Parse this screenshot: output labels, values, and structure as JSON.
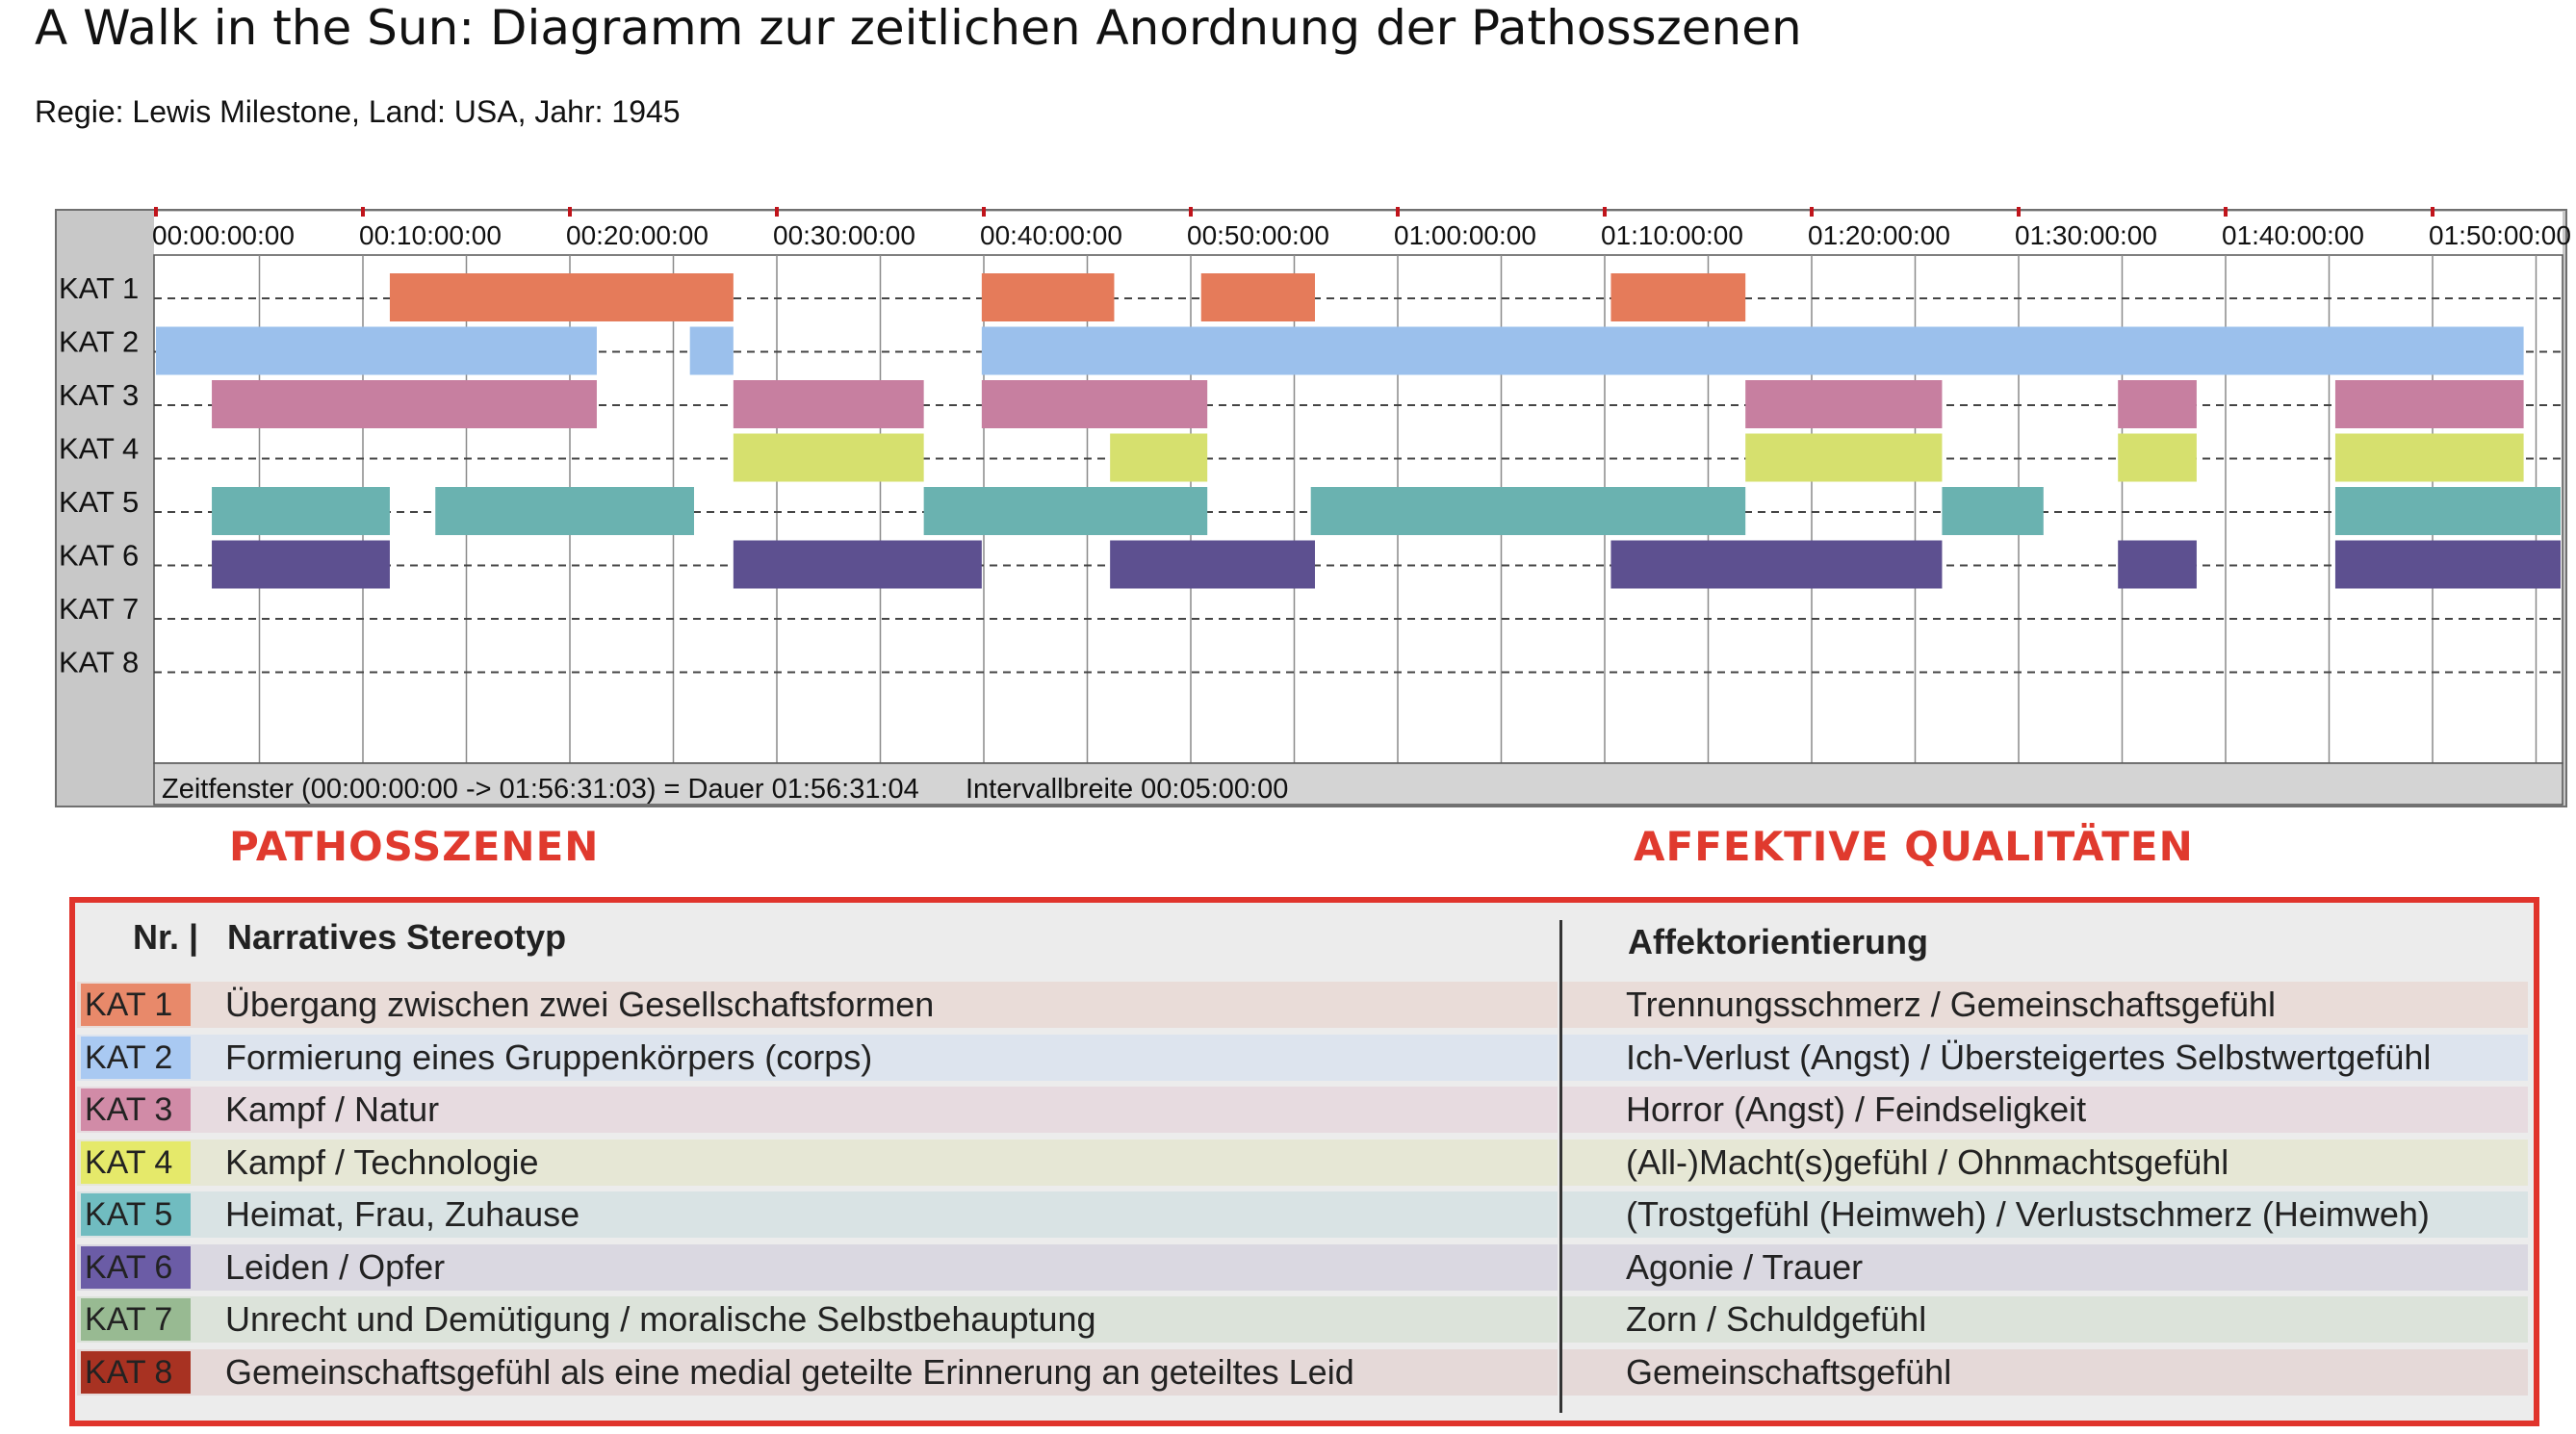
{
  "page": {
    "title": "A Walk in the Sun: Diagramm zur zeitlichen Anordnung der Pathosszenen",
    "subtitle": "Regie: Lewis Milestone, Land: USA, Jahr: 1945"
  },
  "chart_data": {
    "type": "timeline",
    "x_unit": "minutes",
    "xlim": [
      0,
      116.5
    ],
    "x_ticks": [
      {
        "value": 0,
        "label": "00:00:00:00"
      },
      {
        "value": 10,
        "label": "00:10:00:00"
      },
      {
        "value": 20,
        "label": "00:20:00:00"
      },
      {
        "value": 30,
        "label": "00:30:00:00"
      },
      {
        "value": 40,
        "label": "00:40:00:00"
      },
      {
        "value": 50,
        "label": "00:50:00:00"
      },
      {
        "value": 60,
        "label": "01:00:00:00"
      },
      {
        "value": 70,
        "label": "01:10:00:00"
      },
      {
        "value": 80,
        "label": "01:20:00:00"
      },
      {
        "value": 90,
        "label": "01:30:00:00"
      },
      {
        "value": 100,
        "label": "01:40:00:00"
      },
      {
        "value": 110,
        "label": "01:50:00:00"
      }
    ],
    "minor_grid_offset": 5,
    "categories": [
      "KAT 1",
      "KAT 2",
      "KAT 3",
      "KAT 4",
      "KAT 5",
      "KAT 6",
      "KAT 7",
      "KAT 8"
    ],
    "colors": [
      "#e57b5a",
      "#9bc0ec",
      "#c77fa0",
      "#d6e06e",
      "#6ab2b0",
      "#5d5090",
      "#8aaf84",
      "#9a2a1c"
    ],
    "segments": [
      [
        [
          11.3,
          27.9
        ],
        [
          39.9,
          46.3
        ],
        [
          50.5,
          56.0
        ],
        [
          70.3,
          76.8
        ]
      ],
      [
        [
          0,
          21.3
        ],
        [
          25.8,
          27.9
        ],
        [
          39.9,
          114.4
        ]
      ],
      [
        [
          2.7,
          21.3
        ],
        [
          27.9,
          37.1
        ],
        [
          39.9,
          50.8
        ],
        [
          76.8,
          86.3
        ],
        [
          94.8,
          98.6
        ],
        [
          105.3,
          114.4
        ]
      ],
      [
        [
          27.9,
          37.1
        ],
        [
          46.1,
          50.8
        ],
        [
          76.8,
          86.3
        ],
        [
          94.8,
          98.6
        ],
        [
          105.3,
          114.4
        ]
      ],
      [
        [
          2.7,
          11.3
        ],
        [
          13.5,
          26.0
        ],
        [
          37.1,
          50.8
        ],
        [
          55.8,
          76.8
        ],
        [
          86.3,
          91.2
        ],
        [
          105.3,
          116.5
        ]
      ],
      [
        [
          2.7,
          11.3
        ],
        [
          27.9,
          39.9
        ],
        [
          46.1,
          56.0
        ],
        [
          70.3,
          86.3
        ],
        [
          94.8,
          98.6
        ],
        [
          105.3,
          116.5
        ]
      ],
      [],
      []
    ],
    "footer": "Zeitfenster (00:00:00:00 -> 01:56:31:03) = Dauer 01:56:31:04",
    "interval": "Intervallbreite 00:05:00:00"
  },
  "legend": {
    "section_left": "PATHOSSZENEN",
    "section_right": "AFFEKTIVE QUALITÄTEN",
    "header_nr": "Nr. |",
    "header_stereotyp": "Narratives Stereotyp",
    "header_affekt": "Affektorientierung",
    "rows": [
      {
        "kat": "KAT 1",
        "color": "#e8896a",
        "bg_left": "#e9dcd8",
        "bg_right": "#e9dcd8",
        "stereotyp": "Übergang zwischen zwei Gesellschaftsformen",
        "affekt": "Trennungsschmerz / Gemeinschaftsgefühl"
      },
      {
        "kat": "KAT 2",
        "color": "#a9c9f2",
        "bg_left": "#dde4ee",
        "bg_right": "#dde4ee",
        "stereotyp": "Formierung eines Gruppenkörpers (corps)",
        "affekt": "Ich-Verlust (Angst) / Übersteigertes Selbstwertgefühl"
      },
      {
        "kat": "KAT 3",
        "color": "#d18ba7",
        "bg_left": "#e7dbe0",
        "bg_right": "#e7dbe0",
        "stereotyp": "Kampf / Natur",
        "affekt": "Horror (Angst) / Feindseligkeit"
      },
      {
        "kat": "KAT 4",
        "color": "#e5e96a",
        "bg_left": "#e6e7d5",
        "bg_right": "#e6e7d5",
        "stereotyp": "Kampf / Technologie",
        "affekt": "(All-)Macht(s)gefühl / Ohnmachtsgefühl"
      },
      {
        "kat": "KAT 5",
        "color": "#70bcc0",
        "bg_left": "#d9e3e4",
        "bg_right": "#d9e3e4",
        "stereotyp": "Heimat, Frau, Zuhause",
        "affekt": "(Trostgefühl (Heimweh) / Verlustschmerz (Heimweh)"
      },
      {
        "kat": "KAT 6",
        "color": "#6b5ca6",
        "bg_left": "#dad8e1",
        "bg_right": "#dad8e1",
        "stereotyp": "Leiden / Opfer",
        "affekt": "Agonie / Trauer"
      },
      {
        "kat": "KAT 7",
        "color": "#98ba92",
        "bg_left": "#dce3da",
        "bg_right": "#dce3da",
        "stereotyp": "Unrecht und Demütigung / moralische Selbstbehauptung",
        "affekt": "Zorn / Schuldgefühl"
      },
      {
        "kat": "KAT 8",
        "color": "#a83222",
        "bg_left": "#e5d9d8",
        "bg_right": "#e5d9d8",
        "stereotyp": "Gemeinschaftsgefühl als eine medial geteilte Erinnerung an geteiltes Leid",
        "affekt": "Gemeinschaftsgefühl"
      }
    ]
  }
}
